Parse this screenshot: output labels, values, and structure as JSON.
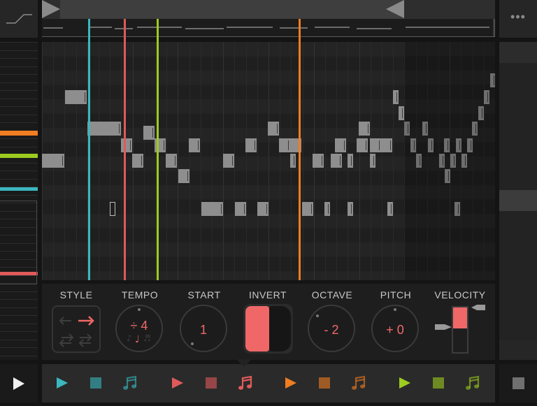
{
  "colors": {
    "track1": "#3ab7c0",
    "track2": "#e05a5a",
    "track3": "#f07d21",
    "track4": "#9ccc1f",
    "accent": "#f06767",
    "note": "#8e8e8e",
    "background": "#141414"
  },
  "icons": {
    "curve": "curve-icon",
    "menu": "more-dots-icon",
    "play": "play-icon",
    "stop": "stop-icon",
    "track_play": "track-play-icon",
    "track_stop": "track-stop-icon",
    "track_note": "music-note-icon"
  },
  "header": {
    "menu_glyph": "•••"
  },
  "controls": {
    "style": {
      "label": "STYLE"
    },
    "tempo": {
      "label": "TEMPO",
      "value": "÷ 4"
    },
    "start": {
      "label": "START",
      "value": "1"
    },
    "invert": {
      "label": "INVERT",
      "state": "on"
    },
    "octave": {
      "label": "OCTAVE",
      "value": "- 2"
    },
    "pitch": {
      "label": "PITCH",
      "value": "+ 0"
    },
    "velocity": {
      "label": "VELOCITY",
      "level": 0.45
    }
  },
  "tracks": [
    {
      "name": "track-1",
      "color": "#3ab7c0",
      "selected": false
    },
    {
      "name": "track-2",
      "color": "#e05a5a",
      "selected": true
    },
    {
      "name": "track-3",
      "color": "#f07d21",
      "selected": false
    },
    {
      "name": "track-4",
      "color": "#9ccc1f",
      "selected": false
    }
  ]
}
